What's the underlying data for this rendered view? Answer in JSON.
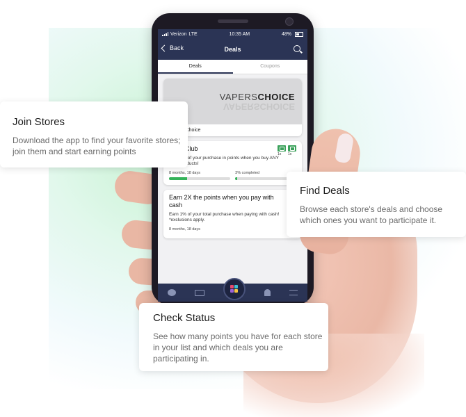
{
  "statusbar": {
    "carrier": "Verizon",
    "network": "LTE",
    "time": "10:35 AM",
    "battery": "48%"
  },
  "navbar": {
    "back_label": "Back",
    "title": "Deals",
    "search_icon": "search-icon"
  },
  "tabs": [
    {
      "label": "Deals",
      "active": true
    },
    {
      "label": "Coupons",
      "active": false
    }
  ],
  "store_card": {
    "logo_part1": "VAPERS",
    "logo_part2": "CHOICE",
    "store_name": "Vapers Choice"
  },
  "deals": [
    {
      "title": "Vape Club",
      "description": "Earn 5% of your purchase in points when you buy ANY vape products!",
      "time_left": "8 months, 18 days",
      "completed": "3% completed",
      "progress": 0.3,
      "badges": [
        "1x",
        "1x"
      ]
    },
    {
      "title": "Earn 2X the points when you pay with cash",
      "description": "Earn 1% of your total purchase when paying with cash! *exclusions apply.",
      "time_left": "8 months, 18 days",
      "badges": [
        "1x"
      ]
    }
  ],
  "bottom_nav": [
    "chat-icon",
    "basket-icon",
    "home-logo-icon",
    "bell-icon",
    "sliders-icon"
  ],
  "callouts": {
    "join": {
      "title": "Join Stores",
      "text": "Download the app to find your favorite stores; join them and start earning points"
    },
    "find": {
      "title": "Find Deals",
      "text": "Browse each store's deals and choose which ones you want to participate it."
    },
    "check": {
      "title": "Check Status",
      "text": "See how many points you have for each store in your list and which deals you are participating in."
    }
  },
  "colors": {
    "navy": "#2b3455",
    "green": "#35b35a",
    "callout_text": "#6a6a6a"
  }
}
